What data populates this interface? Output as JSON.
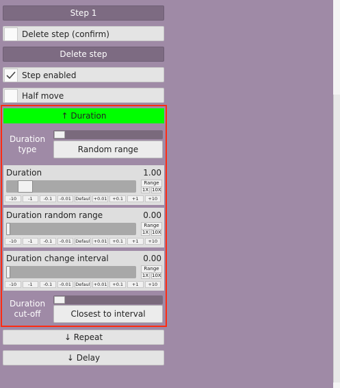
{
  "step_header": "Step 1",
  "delete_confirm": {
    "label": "Delete step (confirm)",
    "checked": false
  },
  "delete_step": "Delete step",
  "step_enabled": {
    "label": "Step enabled",
    "checked": true
  },
  "half_move": {
    "label": "Half move",
    "checked": false
  },
  "duration_section": {
    "header": "↑ Duration",
    "duration_type": {
      "label": "Duration type",
      "value": "Random range"
    },
    "sliders": [
      {
        "title": "Duration",
        "value": "1.00",
        "fill": 0.1
      },
      {
        "title": "Duration random range",
        "value": "0.00",
        "fill": 0.0
      },
      {
        "title": "Duration change interval",
        "value": "0.00",
        "fill": 0.0
      }
    ],
    "range": {
      "label": "Range",
      "one": "1X",
      "ten": "10X"
    },
    "steps": [
      "-10",
      "-1",
      "-0.1",
      "-0.01",
      "Default",
      "+0.01",
      "+0.1",
      "+1",
      "+10"
    ],
    "duration_cutoff": {
      "label": "Duration cut-off",
      "value": "Closest to interval"
    }
  },
  "repeat_section": "↓ Repeat",
  "delay_section": "↓ Delay",
  "icons": {
    "check": "checkmark-icon"
  }
}
